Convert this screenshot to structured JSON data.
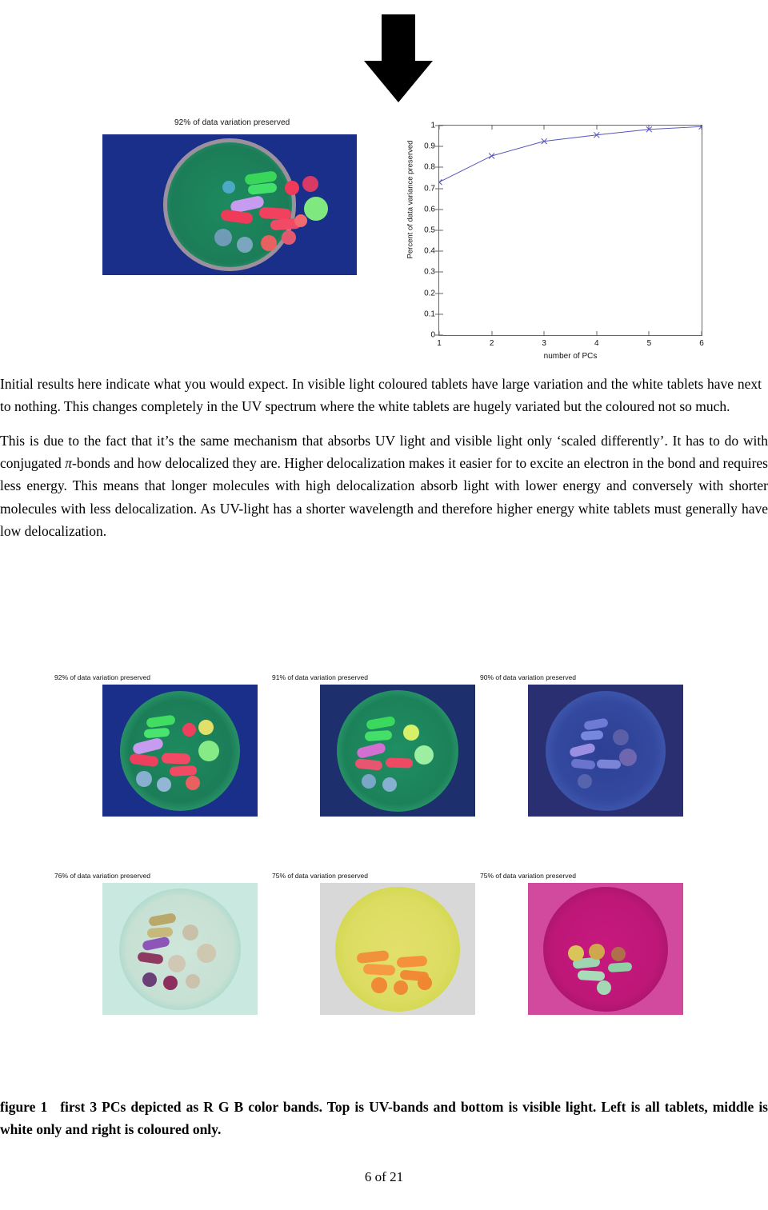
{
  "top_figure": {
    "caption": "92% of data variation preserved",
    "image_name": "petri-dish-uv-pc-composite"
  },
  "chart_data": {
    "type": "line",
    "title": "",
    "xlabel": "number of PCs",
    "ylabel": "Percent of data variance preserved",
    "x": [
      1,
      2,
      3,
      4,
      5,
      6
    ],
    "values": [
      0.73,
      0.855,
      0.925,
      0.955,
      0.982,
      0.995
    ],
    "series": [
      {
        "name": "variance preserved",
        "values": [
          0.73,
          0.855,
          0.925,
          0.955,
          0.982,
          0.995
        ]
      }
    ],
    "xticks": [
      "1",
      "2",
      "3",
      "4",
      "5",
      "6"
    ],
    "yticks": [
      "0",
      "0.1",
      "0.2",
      "0.3",
      "0.4",
      "0.5",
      "0.6",
      "0.7",
      "0.8",
      "0.9",
      "1"
    ],
    "xlim": [
      1,
      6
    ],
    "ylim": [
      0,
      1
    ],
    "grid": false,
    "legend": "none",
    "marker": "x",
    "line_color": "#5555bb"
  },
  "body": {
    "paragraph1": "Initial results here indicate what you would expect. In visible light coloured tablets have large variation and the white tablets have next to nothing. This changes completely in the UV spectrum where the white tablets are hugely variated but the coloured not so much.",
    "paragraph2_part1": "This is due to the fact that it’s the same mechanism that absorbs UV light and visible light only ‘scaled differently’. It has to do with conjugated ",
    "paragraph2_pi": "π",
    "paragraph2_part2": "-bonds and how delocalized they are. Higher delocalization makes it easier for to excite an electron in the bond and requires less energy. This means that longer molecules with high delocalization absorb light with lower energy and conversely with shorter molecules with less delocalization. As UV-light has a shorter wavelength and therefore higher energy white tablets must generally have low delocalization."
  },
  "figure_grid": {
    "cells": [
      {
        "caption": "92% of data variation preserved",
        "name": "uv-all-tablets"
      },
      {
        "caption": "91% of data variation preserved",
        "name": "uv-white-only"
      },
      {
        "caption": "90% of data variation preserved",
        "name": "uv-coloured-only"
      },
      {
        "caption": "76% of data variation preserved",
        "name": "visible-all-tablets"
      },
      {
        "caption": "75% of data variation preserved",
        "name": "visible-white-only"
      },
      {
        "caption": "75% of data variation preserved",
        "name": "visible-coloured-only"
      }
    ]
  },
  "figure_caption": {
    "label": "figure 1",
    "text": "first 3 PCs depicted as R G B color bands. Top is UV-bands and bottom is visible light. Left is all tablets, middle is white only and right is coloured only."
  },
  "footer": {
    "page": "6 of 21"
  }
}
